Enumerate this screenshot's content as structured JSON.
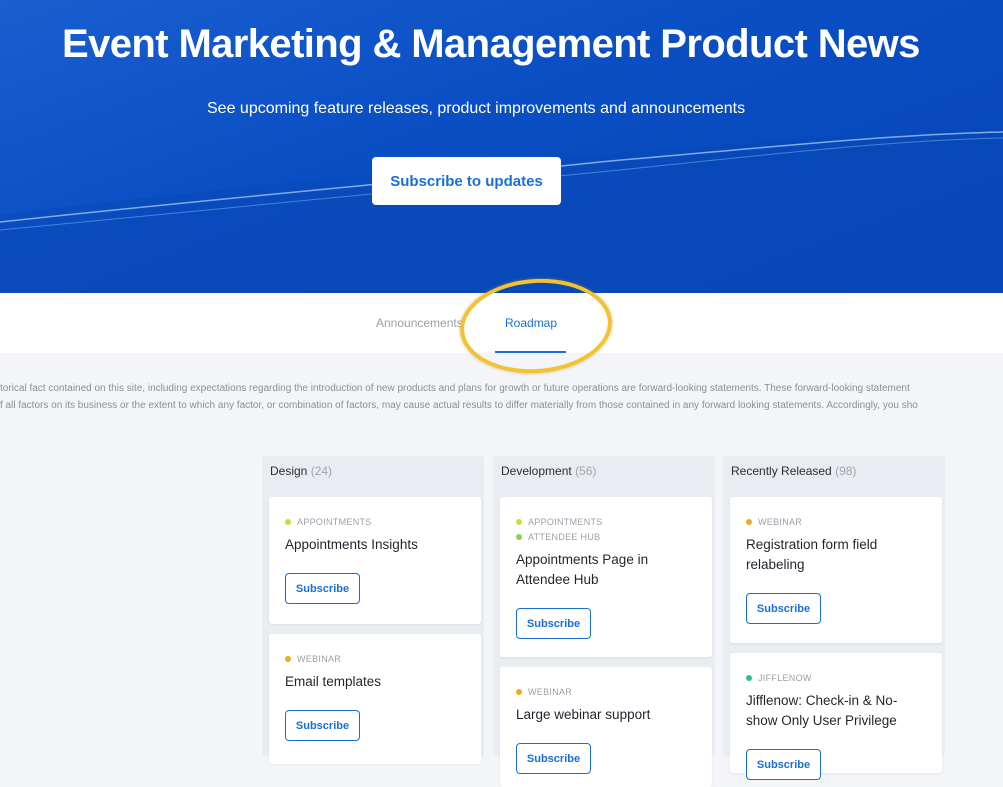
{
  "hero": {
    "title": "Event Marketing & Management Product News",
    "subtitle": "See upcoming feature releases, product improvements and announcements",
    "subscribe_label": "Subscribe to updates"
  },
  "tabs": [
    {
      "label": "Announcements",
      "active": false
    },
    {
      "label": "Roadmap",
      "active": true
    }
  ],
  "disclaimer": {
    "line1": "torical fact contained on this site, including expectations regarding the introduction of new products and plans for growth or future operations are forward-looking statements. These forward-looking statement",
    "line2": "f all factors on its business or the extent to which any factor, or combination of factors, may cause actual results to differ materially from those contained in any forward looking statements. Accordingly, you sho"
  },
  "colors": {
    "accent": "#1a6fd6",
    "highlight_ring": "#f1c232",
    "tag_appointments": "#c6e03a",
    "tag_attendee_hub": "#8bd14a",
    "tag_webinar": "#f5a623",
    "tag_jifflenow": "#27c28a"
  },
  "columns": [
    {
      "name": "Design",
      "count": "(24)",
      "cards": [
        {
          "tags": [
            {
              "label": "APPOINTMENTS",
              "color": "#c6e03a"
            }
          ],
          "title": "Appointments Insights",
          "button": "Subscribe"
        },
        {
          "tags": [
            {
              "label": "WEBINAR",
              "color": "#f5a623"
            }
          ],
          "title": "Email templates",
          "button": "Subscribe"
        }
      ]
    },
    {
      "name": "Development",
      "count": "(56)",
      "cards": [
        {
          "tags": [
            {
              "label": "APPOINTMENTS",
              "color": "#c6e03a"
            },
            {
              "label": "ATTENDEE HUB",
              "color": "#8bd14a"
            }
          ],
          "title": "Appointments Page in Attendee Hub",
          "button": "Subscribe"
        },
        {
          "tags": [
            {
              "label": "WEBINAR",
              "color": "#f5a623"
            }
          ],
          "title": "Large webinar support",
          "button": "Subscribe"
        }
      ]
    },
    {
      "name": "Recently Released",
      "count": "(98)",
      "cards": [
        {
          "tags": [
            {
              "label": "WEBINAR",
              "color": "#f5a623"
            }
          ],
          "title": "Registration form field relabeling",
          "button": "Subscribe"
        },
        {
          "tags": [
            {
              "label": "JIFFLENOW",
              "color": "#27c28a"
            }
          ],
          "title": "Jifflenow: Check-in & No-show Only User Privilege",
          "button": "Subscribe"
        }
      ]
    }
  ]
}
